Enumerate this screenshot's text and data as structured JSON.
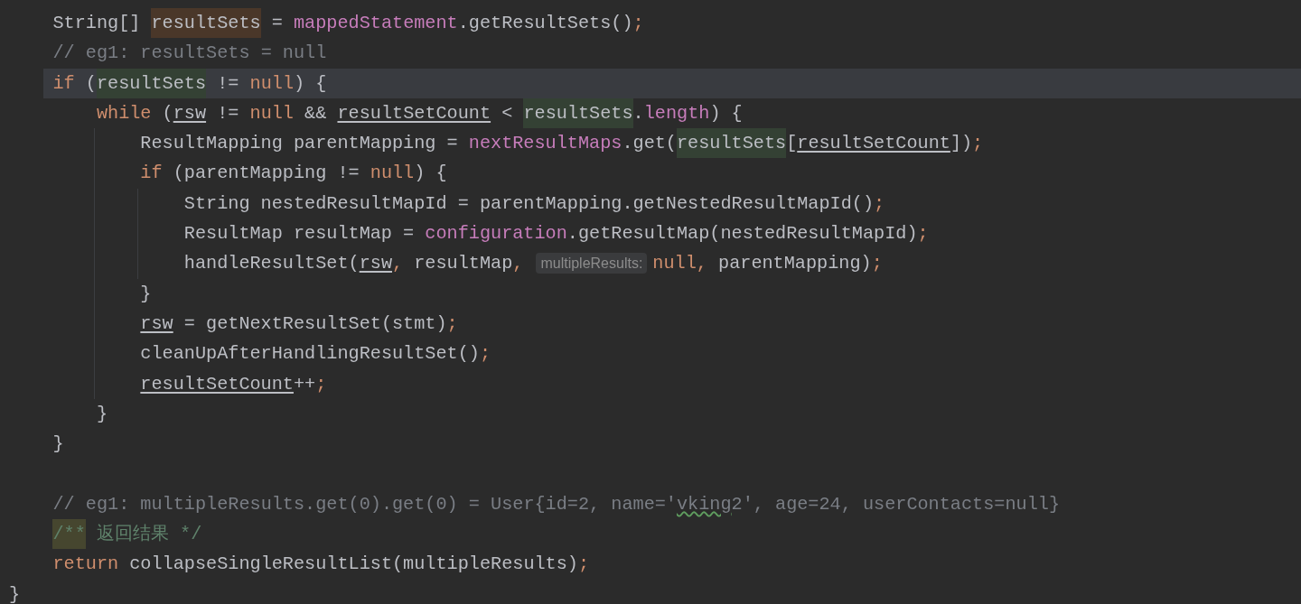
{
  "editor": {
    "body": [
      {
        "current": false,
        "tokens": [
          {
            "kind": "plain",
            "text": "String[] "
          },
          {
            "kind": "plain",
            "text": "resultSets",
            "color": "#4a3729"
          },
          {
            "kind": "plain",
            "text": " = "
          },
          {
            "kind": "field",
            "text": "mappedStatement"
          },
          {
            "kind": "plain",
            "text": ".getResultSets()"
          },
          {
            "kind": "punct",
            "text": ";"
          }
        ]
      },
      {
        "current": false,
        "tokens": [
          {
            "kind": "comment",
            "text": "// eg1: resultSets = null"
          }
        ]
      },
      {
        "current": true,
        "tokens": [
          {
            "kind": "keyword",
            "text": "if"
          },
          {
            "kind": "plain",
            "text": " ("
          },
          {
            "kind": "plain",
            "text": "resultSets",
            "color": "#344134"
          },
          {
            "kind": "plain",
            "text": " != "
          },
          {
            "kind": "keyword",
            "text": "null"
          },
          {
            "kind": "plain",
            "text": ") {"
          }
        ],
        "children": [
          {
            "current": false,
            "tokens": [
              {
                "kind": "keyword",
                "text": "while"
              },
              {
                "kind": "plain",
                "text": " ("
              },
              {
                "kind": "plain",
                "text": "rsw",
                "underline": true
              },
              {
                "kind": "plain",
                "text": " != "
              },
              {
                "kind": "keyword",
                "text": "null"
              },
              {
                "kind": "plain",
                "text": " && "
              },
              {
                "kind": "plain",
                "text": "resultSetCount",
                "underline": true
              },
              {
                "kind": "plain",
                "text": " < "
              },
              {
                "kind": "plain",
                "text": "resultSets",
                "color": "#344134"
              },
              {
                "kind": "plain",
                "text": "."
              },
              {
                "kind": "field",
                "text": "length"
              },
              {
                "kind": "plain",
                "text": ") {"
              }
            ],
            "children": [
              {
                "current": false,
                "tokens": [
                  {
                    "kind": "plain",
                    "text": "ResultMapping parentMapping = "
                  },
                  {
                    "kind": "field",
                    "text": "nextResultMaps"
                  },
                  {
                    "kind": "plain",
                    "text": ".get("
                  },
                  {
                    "kind": "plain",
                    "text": "resultSets",
                    "color": "#344134"
                  },
                  {
                    "kind": "plain",
                    "text": "["
                  },
                  {
                    "kind": "plain",
                    "text": "resultSetCount",
                    "underline": true
                  },
                  {
                    "kind": "plain",
                    "text": "])"
                  },
                  {
                    "kind": "punct",
                    "text": ";"
                  }
                ]
              },
              {
                "current": false,
                "tokens": [
                  {
                    "kind": "keyword",
                    "text": "if"
                  },
                  {
                    "kind": "plain",
                    "text": " (parentMapping != "
                  },
                  {
                    "kind": "keyword",
                    "text": "null"
                  },
                  {
                    "kind": "plain",
                    "text": ") {"
                  }
                ],
                "children": [
                  {
                    "current": false,
                    "tokens": [
                      {
                        "kind": "plain",
                        "text": "String nestedResultMapId = parentMapping.getNestedResultMapId()"
                      },
                      {
                        "kind": "punct",
                        "text": ";"
                      }
                    ]
                  },
                  {
                    "current": false,
                    "tokens": [
                      {
                        "kind": "plain",
                        "text": "ResultMap resultMap = "
                      },
                      {
                        "kind": "field",
                        "text": "configuration"
                      },
                      {
                        "kind": "plain",
                        "text": ".getResultMap(nestedResultMapId)"
                      },
                      {
                        "kind": "punct",
                        "text": ";"
                      }
                    ]
                  },
                  {
                    "current": false,
                    "tokens": [
                      {
                        "kind": "plain",
                        "text": "handleResultSet("
                      },
                      {
                        "kind": "plain",
                        "text": "rsw",
                        "underline": true
                      },
                      {
                        "kind": "punct",
                        "text": ","
                      },
                      {
                        "kind": "plain",
                        "text": " resultMap"
                      },
                      {
                        "kind": "punct",
                        "text": ","
                      },
                      {
                        "kind": "hint",
                        "text": "multipleResults:"
                      },
                      {
                        "kind": "keyword",
                        "text": "null"
                      },
                      {
                        "kind": "punct",
                        "text": ","
                      },
                      {
                        "kind": "plain",
                        "text": " parentMapping)"
                      },
                      {
                        "kind": "punct",
                        "text": ";"
                      }
                    ]
                  }
                ]
              },
              {
                "current": false,
                "tokens": [
                  {
                    "kind": "plain",
                    "text": "}"
                  }
                ]
              },
              {
                "current": false,
                "tokens": [
                  {
                    "kind": "plain",
                    "text": "rsw",
                    "underline": true
                  },
                  {
                    "kind": "plain",
                    "text": " = getNextResultSet(stmt)"
                  },
                  {
                    "kind": "punct",
                    "text": ";"
                  }
                ]
              },
              {
                "current": false,
                "tokens": [
                  {
                    "kind": "plain",
                    "text": "cleanUpAfterHandlingResultSet()"
                  },
                  {
                    "kind": "punct",
                    "text": ";"
                  }
                ]
              },
              {
                "current": false,
                "tokens": [
                  {
                    "kind": "plain",
                    "text": "resultSetCount",
                    "underline": true
                  },
                  {
                    "kind": "plain",
                    "text": "++"
                  },
                  {
                    "kind": "punct",
                    "text": ";"
                  }
                ]
              }
            ]
          },
          {
            "current": false,
            "tokens": [
              {
                "kind": "plain",
                "text": "}"
              }
            ]
          }
        ]
      },
      {
        "current": false,
        "tokens": [
          {
            "kind": "plain",
            "text": "}"
          }
        ]
      },
      {
        "current": false
      },
      {
        "current": false,
        "tokens": [
          {
            "kind": "comment",
            "text": "// eg1: multipleResults.get(0).get(0) = User{id=2, name='"
          },
          {
            "kind": "comment",
            "text": "vking",
            "typo": true
          },
          {
            "kind": "comment",
            "text": "2', age=24, userContacts=null}"
          }
        ]
      },
      {
        "current": false,
        "tokens": [
          {
            "kind": "doc",
            "text": "/**",
            "color": "#46462f"
          },
          {
            "kind": "doc",
            "text": " 返回结果 */"
          }
        ]
      },
      {
        "current": false,
        "tokens": [
          {
            "kind": "keyword",
            "text": "return"
          },
          {
            "kind": "plain",
            "text": " collapseSingleResultList(multipleResults)"
          },
          {
            "kind": "punct",
            "text": ";"
          }
        ]
      }
    ],
    "tail": [
      {
        "current": false,
        "tokens": [
          {
            "kind": "plain",
            "text": "}"
          }
        ]
      }
    ]
  }
}
